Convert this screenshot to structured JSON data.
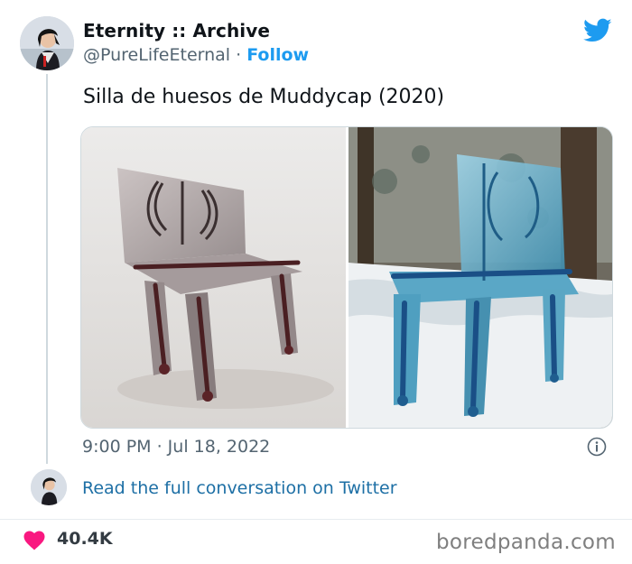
{
  "tweet": {
    "author_name": "Eternity :: Archive",
    "handle": "@PureLifeEternal",
    "separator": " · ",
    "follow_label": "Follow",
    "text": "Silla de huesos de Muddycap (2020)",
    "timestamp": "9:00 PM · Jul 18, 2022",
    "read_more_label": "Read the full conversation on Twitter",
    "like_count": "40.4K"
  },
  "footer": {
    "watermark": "boredpanda.com"
  },
  "colors": {
    "twitter_blue": "#1d9bf0",
    "link_blue": "#1d6fa5",
    "heart_pink": "#f91880",
    "secondary_text": "#536471"
  },
  "icons": {
    "brand": "twitter-bird-icon",
    "info": "info-icon",
    "like": "heart-icon"
  }
}
